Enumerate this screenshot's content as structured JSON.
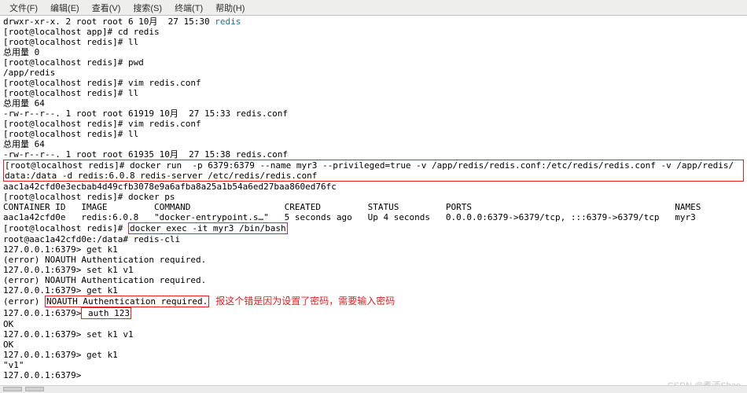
{
  "menubar": {
    "file": "文件(F)",
    "edit": "编辑(E)",
    "view": "查看(V)",
    "search": "搜索(S)",
    "terminal": "终端(T)",
    "help": "帮助(H)"
  },
  "term": {
    "l1a": "drwxr-xr-x. 2 root root 6 10月  27 15:30 ",
    "l1b": "redis",
    "l2": "[root@localhost app]# cd redis",
    "l3": "[root@localhost redis]# ll",
    "l4": "总用量 0",
    "l5": "[root@localhost redis]# pwd",
    "l6": "/app/redis",
    "l7": "[root@localhost redis]# vim redis.conf",
    "l8": "[root@localhost redis]# ll",
    "l9": "总用量 64",
    "l10": "-rw-r--r--. 1 root root 61919 10月  27 15:33 redis.conf",
    "l11": "[root@localhost redis]# vim redis.conf",
    "l12": "[root@localhost redis]# ll",
    "l13": "总用量 64",
    "l14": "-rw-r--r--. 1 root root 61935 10月  27 15:38 redis.conf",
    "lboxed1": "[root@localhost redis]# docker run  -p 6379:6379 --name myr3 --privileged=true -v /app/redis/redis.conf:/etc/redis/redis.conf -v /app/redis/",
    "lboxed2": "data:/data -d redis:6.0.8 redis-server /etc/redis/redis.conf",
    "l15": "aac1a42cfd0e3ecbab4d49cfb3078e9a6afba8a25a1b54a6ed27baa860ed76fc",
    "l16": "[root@localhost redis]# docker ps",
    "l17": "CONTAINER ID   IMAGE         COMMAND                  CREATED         STATUS         PORTS                                       NAMES",
    "l18": "aac1a42cfd0e   redis:6.0.8   \"docker-entrypoint.s…\"   5 seconds ago   Up 4 seconds   0.0.0.0:6379->6379/tcp, :::6379->6379/tcp   myr3",
    "l19a": "[root@localhost redis]# ",
    "l19b": "docker exec -it myr3 /bin/bash",
    "l20": "root@aac1a42cfd0e:/data# redis-cli",
    "l21": "127.0.0.1:6379> get k1",
    "l22": "(error) NOAUTH Authentication required.",
    "l23": "127.0.0.1:6379> set k1 v1",
    "l24": "(error) NOAUTH Authentication required.",
    "l25": "127.0.0.1:6379> get k1",
    "l26a": "(error) ",
    "l26b": "NOAUTH Authentication required.",
    "annotation": "报这个错是因为设置了密码，需要输入密码",
    "l27a": "127.0.0.1:6379>",
    "l27b": " auth 123",
    "l28": "OK",
    "l29": "127.0.0.1:6379> set k1 v1",
    "l30": "OK",
    "l31": "127.0.0.1:6379> get k1",
    "l32": "\"v1\"",
    "l33": "127.0.0.1:6379> "
  },
  "watermark": "CSDN @煮酒Shae"
}
